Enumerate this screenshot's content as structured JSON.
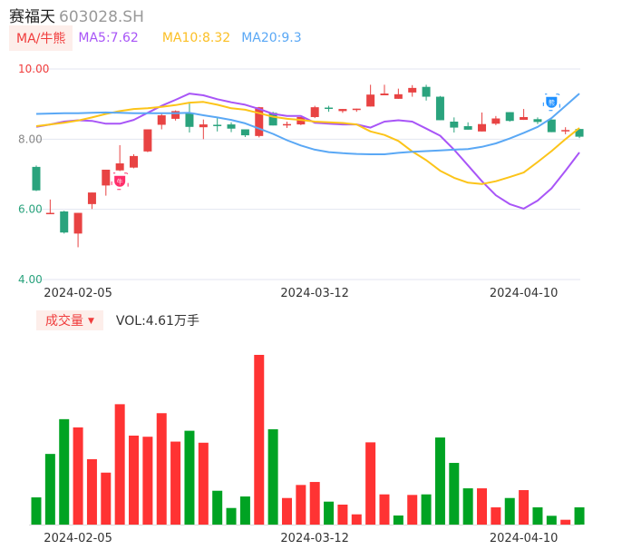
{
  "header": {
    "name": "赛福天",
    "code": "603028.SH"
  },
  "legend": {
    "button": "MA/牛熊",
    "ma5": "MA5:7.62",
    "ma10": "MA10:8.32",
    "ma20": "MA20:9.3"
  },
  "volume_header": {
    "button": "成交量",
    "dropdown_icon": "▼",
    "value": "VOL:4.61万手"
  },
  "colors": {
    "up": "#e84343",
    "down": "#2aa37d",
    "vol_up": "#ff3333",
    "vol_down": "#00a323",
    "ma5": "#a855f7",
    "ma10": "#fcc419",
    "ma20": "#5aa8f5",
    "grid": "#e3e6f0"
  },
  "markers": [
    {
      "label": "牛",
      "index": 6,
      "price": 6.8,
      "color": "#ff2d6a"
    },
    {
      "label": "熊",
      "index": 37,
      "price": 9.05,
      "color": "#1e90ff"
    }
  ],
  "chart_data": [
    {
      "type": "candlestick",
      "title": "赛福天 603028.SH",
      "ylim": [
        4.0,
        10.0
      ],
      "yticks": [
        {
          "label": "10.00",
          "value": 10,
          "color": "#f03c3c"
        },
        {
          "label": "8.00",
          "value": 8,
          "color": "#888888"
        },
        {
          "label": "6.00",
          "value": 6,
          "color": "#2aa37d"
        },
        {
          "label": "4.00",
          "value": 4,
          "color": "#2aa37d"
        }
      ],
      "xticks": [
        {
          "label": "2024-02-05",
          "index": 3
        },
        {
          "label": "2024-03-12",
          "index": 20
        },
        {
          "label": "2024-04-10",
          "index": 35
        }
      ],
      "candles": [
        [
          7.21,
          6.54,
          7.25,
          6.52
        ],
        [
          5.88,
          5.9,
          6.28,
          5.88
        ],
        [
          5.94,
          5.34,
          5.96,
          5.31
        ],
        [
          5.31,
          5.9,
          5.9,
          4.92
        ],
        [
          6.15,
          6.48,
          6.48,
          6.01
        ],
        [
          6.68,
          7.13,
          7.13,
          6.39
        ],
        [
          7.11,
          7.31,
          7.83,
          7.09
        ],
        [
          7.19,
          7.52,
          7.57,
          7.17
        ],
        [
          7.65,
          8.28,
          8.28,
          7.63
        ],
        [
          8.41,
          8.68,
          8.72,
          8.28
        ],
        [
          8.58,
          8.8,
          8.82,
          8.53
        ],
        [
          8.75,
          8.35,
          9.04,
          8.19
        ],
        [
          8.34,
          8.42,
          8.56,
          8.0
        ],
        [
          8.41,
          8.39,
          8.61,
          8.22
        ],
        [
          8.42,
          8.3,
          8.48,
          8.2
        ],
        [
          8.28,
          8.11,
          8.28,
          8.06
        ],
        [
          8.09,
          8.91,
          8.92,
          8.05
        ],
        [
          8.75,
          8.39,
          8.78,
          8.39
        ],
        [
          8.41,
          8.43,
          8.5,
          8.32
        ],
        [
          8.42,
          8.63,
          8.63,
          8.4
        ],
        [
          8.63,
          8.91,
          8.95,
          8.6
        ],
        [
          8.9,
          8.87,
          8.95,
          8.78
        ],
        [
          8.8,
          8.86,
          8.86,
          8.75
        ],
        [
          8.83,
          8.87,
          8.87,
          8.78
        ],
        [
          8.93,
          9.27,
          9.55,
          8.93
        ],
        [
          9.25,
          9.3,
          9.55,
          9.25
        ],
        [
          9.15,
          9.28,
          9.44,
          9.15
        ],
        [
          9.33,
          9.46,
          9.54,
          9.21
        ],
        [
          9.49,
          9.21,
          9.55,
          9.1
        ],
        [
          9.21,
          8.54,
          9.23,
          8.54
        ],
        [
          8.5,
          8.33,
          8.62,
          8.19
        ],
        [
          8.37,
          8.27,
          8.48,
          8.27
        ],
        [
          8.22,
          8.43,
          8.76,
          8.22
        ],
        [
          8.44,
          8.59,
          8.66,
          8.4
        ],
        [
          8.77,
          8.52,
          8.77,
          8.5
        ],
        [
          8.55,
          8.63,
          8.86,
          8.55
        ],
        [
          8.57,
          8.49,
          8.62,
          8.43
        ],
        [
          8.56,
          8.2,
          8.56,
          8.2
        ],
        [
          8.23,
          8.26,
          8.34,
          8.14
        ],
        [
          8.29,
          8.07,
          8.29,
          8.03
        ]
      ],
      "candle_fields": [
        "open",
        "close",
        "high",
        "low"
      ],
      "series": [
        {
          "name": "MA5",
          "values": [
            8.35,
            8.42,
            8.5,
            8.54,
            8.52,
            8.44,
            8.44,
            8.55,
            8.75,
            8.95,
            9.12,
            9.3,
            9.25,
            9.14,
            9.05,
            8.98,
            8.86,
            8.72,
            8.66,
            8.66,
            8.47,
            8.44,
            8.42,
            8.42,
            8.33,
            8.5,
            8.54,
            8.5,
            8.3,
            8.1,
            7.7,
            7.25,
            6.8,
            6.4,
            6.15,
            6.02,
            6.25,
            6.6,
            7.1,
            7.62
          ]
        },
        {
          "name": "MA10",
          "values": [
            8.37,
            8.42,
            8.47,
            8.53,
            8.62,
            8.72,
            8.8,
            8.86,
            8.88,
            8.92,
            8.97,
            9.04,
            9.06,
            8.98,
            8.88,
            8.84,
            8.74,
            8.64,
            8.58,
            8.55,
            8.5,
            8.48,
            8.46,
            8.42,
            8.22,
            8.12,
            7.95,
            7.65,
            7.4,
            7.1,
            6.9,
            6.76,
            6.72,
            6.8,
            6.92,
            7.05,
            7.35,
            7.66,
            8.0,
            8.32
          ]
        },
        {
          "name": "MA20",
          "values": [
            8.72,
            8.73,
            8.74,
            8.74,
            8.75,
            8.76,
            8.75,
            8.74,
            8.74,
            8.74,
            8.74,
            8.75,
            8.68,
            8.62,
            8.55,
            8.45,
            8.3,
            8.15,
            7.97,
            7.82,
            7.7,
            7.63,
            7.6,
            7.58,
            7.57,
            7.57,
            7.61,
            7.64,
            7.66,
            7.68,
            7.7,
            7.72,
            7.78,
            7.88,
            8.02,
            8.18,
            8.35,
            8.6,
            8.95,
            9.3
          ]
        }
      ]
    },
    {
      "type": "bar",
      "title": "成交量",
      "unit": "万手",
      "ylim": [
        0,
        46
      ],
      "values": [
        7.28,
        18.9,
        28.2,
        26.0,
        17.5,
        13.9,
        32.2,
        23.8,
        23.5,
        29.8,
        22.2,
        25.1,
        21.9,
        9.05,
        4.44,
        7.52,
        45.4,
        25.5,
        7.11,
        10.6,
        11.4,
        6.14,
        5.34,
        2.74,
        22.0,
        8.08,
        2.43,
        7.93,
        8.08,
        23.3,
        16.5,
        9.7,
        9.7,
        4.61,
        7.11,
        9.22,
        4.61,
        2.35,
        1.29,
        4.61
      ],
      "up": [
        0,
        0,
        0,
        1,
        1,
        1,
        1,
        1,
        1,
        1,
        1,
        0,
        1,
        0,
        0,
        0,
        1,
        0,
        1,
        1,
        1,
        0,
        1,
        1,
        1,
        1,
        0,
        1,
        0,
        0,
        0,
        0,
        1,
        1,
        0,
        1,
        0,
        0,
        1,
        0
      ],
      "xticks": [
        {
          "label": "2024-02-05",
          "index": 3
        },
        {
          "label": "2024-03-12",
          "index": 20
        },
        {
          "label": "2024-04-10",
          "index": 35
        }
      ]
    }
  ]
}
